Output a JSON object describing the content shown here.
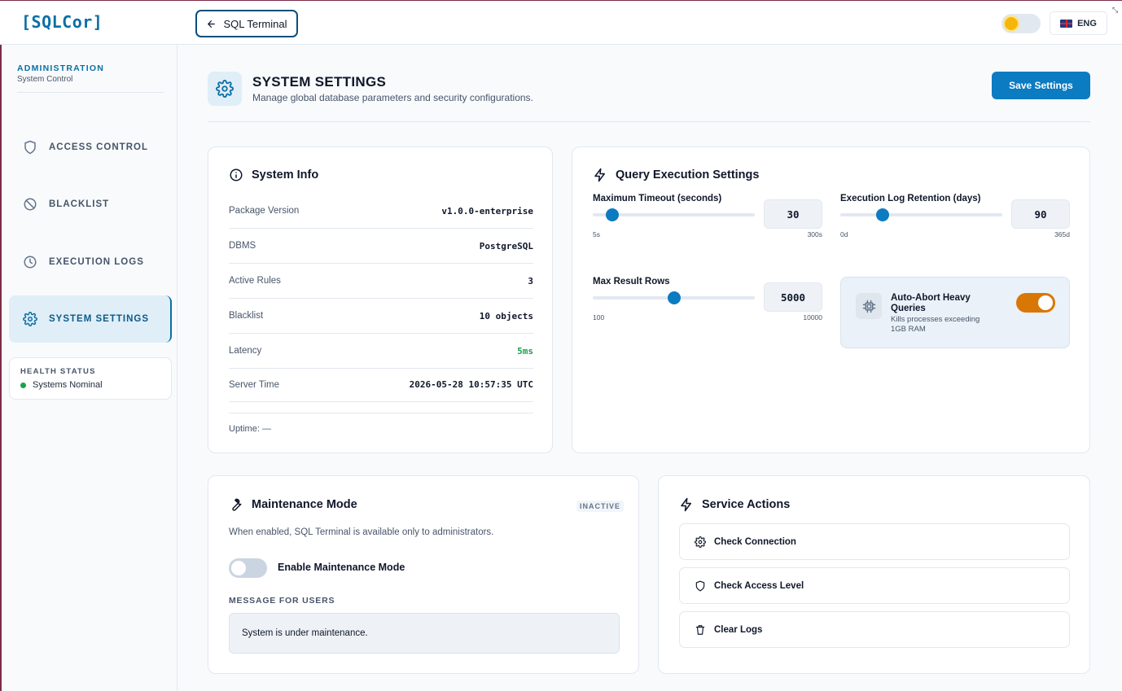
{
  "app": {
    "logo": "[SQLCor]"
  },
  "topbar": {
    "back_label": "SQL Terminal",
    "lang_label": "ENG"
  },
  "sidebar": {
    "title": "ADMINISTRATION",
    "subtitle": "System Control",
    "items": [
      {
        "label": "ACCESS CONTROL",
        "icon": "shield-icon",
        "active": false
      },
      {
        "label": "BLACKLIST",
        "icon": "ban-icon",
        "active": false
      },
      {
        "label": "EXECUTION LOGS",
        "icon": "clock-icon",
        "active": false
      },
      {
        "label": "SYSTEM SETTINGS",
        "icon": "gear-icon",
        "active": true
      }
    ],
    "health": {
      "title": "HEALTH STATUS",
      "status": "Systems Nominal",
      "status_color": "#16a34a"
    }
  },
  "header": {
    "title": "SYSTEM SETTINGS",
    "subtitle": "Manage global database parameters and security configurations.",
    "save_label": "Save Settings"
  },
  "system_info": {
    "title": "System Info",
    "rows": [
      {
        "label": "Package Version",
        "value": "v1.0.0-enterprise"
      },
      {
        "label": "DBMS",
        "value": "PostgreSQL"
      },
      {
        "label": "Active Rules",
        "value": "3"
      },
      {
        "label": "Blacklist",
        "value": "10 objects"
      },
      {
        "label": "Latency",
        "value": "5ms"
      },
      {
        "label": "Server Time",
        "value": "2026-05-28 10:57:35 UTC"
      }
    ],
    "uptime": "Uptime: —"
  },
  "query_exec": {
    "title": "Query Execution Settings",
    "timeout": {
      "label": "Maximum Timeout (seconds)",
      "value": "30",
      "min": "5s",
      "max": "300s",
      "fraction": 0.12
    },
    "retention": {
      "label": "Execution Log Retention (days)",
      "value": "90",
      "min": "0d",
      "max": "365d",
      "fraction": 0.26
    },
    "rows": {
      "label": "Max Result Rows",
      "value": "5000",
      "min": "100",
      "max": "10000",
      "fraction": 0.5
    },
    "auto_abort": {
      "title": "Auto-Abort Heavy Queries",
      "desc": "Kills processes exceeding 1GB RAM",
      "enabled": true
    }
  },
  "maintenance": {
    "title": "Maintenance Mode",
    "badge": "INACTIVE",
    "desc": "When enabled, SQL Terminal is available only to administrators.",
    "toggle_label": "Enable Maintenance Mode",
    "enabled": false,
    "message_label": "MESSAGE FOR USERS",
    "message_value": "System is under maintenance."
  },
  "service_actions": {
    "title": "Service Actions",
    "buttons": [
      {
        "label": "Check Connection",
        "icon": "gear-icon"
      },
      {
        "label": "Check Access Level",
        "icon": "shield-icon"
      },
      {
        "label": "Clear Logs",
        "icon": "trash-icon"
      }
    ]
  },
  "colors": {
    "accent": "#0b7bc2",
    "toggle_on": "#d97706",
    "latency": "#16a34a"
  }
}
